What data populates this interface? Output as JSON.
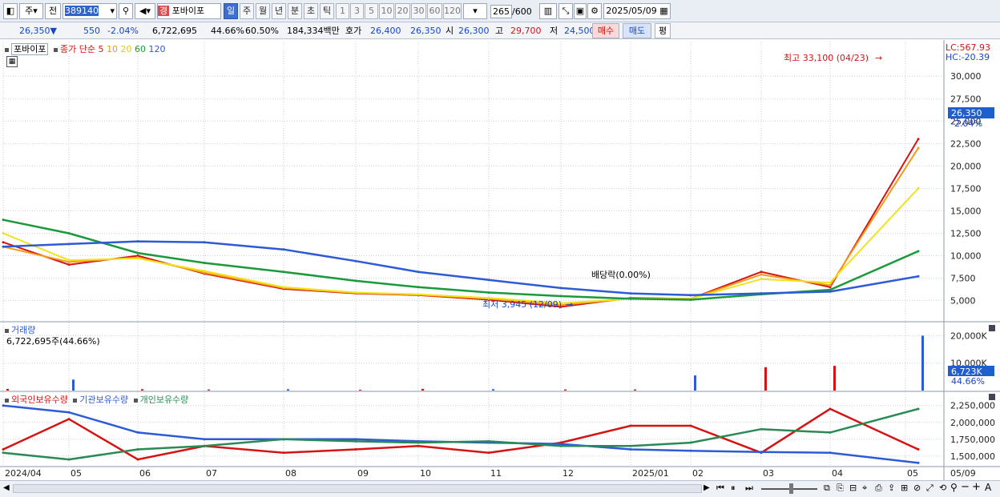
{
  "toolbar": {
    "market_label": "주",
    "prev_label": "전",
    "stock_code": "389140",
    "market_badge": "경",
    "stock_name": "포바이포",
    "periods": [
      "일",
      "주",
      "월",
      "년",
      "분",
      "초",
      "틱"
    ],
    "selected_period": "일",
    "intervals": [
      "1",
      "3",
      "5",
      "10",
      "20",
      "30",
      "60",
      "120"
    ],
    "count_value": "265",
    "count_max": "/600",
    "date_value": "2025/05/09"
  },
  "quote": {
    "price": "26,350",
    "change_arrow": "▼",
    "change": "550",
    "change_pct": "-2.04%",
    "volume": "6,722,695",
    "volume_ratio": "44.66%",
    "turnover": "60.50%",
    "amount": "184,334백만",
    "ask_label": "호가",
    "ask": "26,400",
    "bid": "26,350",
    "open_label": "시",
    "open": "26,300",
    "high_label": "고",
    "high": "29,700",
    "low_label": "저",
    "low": "24,500",
    "buy_label": "매수",
    "sell_label": "매도",
    "avg_label": "평"
  },
  "price_panel": {
    "name": "포바이포",
    "ma_label": "종가 단순",
    "ma_periods": [
      {
        "label": "5",
        "color": "#d61313"
      },
      {
        "label": "10",
        "color": "#f29a1a"
      },
      {
        "label": "20",
        "color": "#f2e21c"
      },
      {
        "label": "60",
        "color": "#1a9a3a"
      },
      {
        "label": "120",
        "color": "#2d5bd6"
      }
    ],
    "lc_label": "LC:567.93",
    "hc_label": "HC:-20.39",
    "y_ticks": [
      "30,000",
      "27,500",
      "25,000",
      "22,500",
      "20,000",
      "17,500",
      "15,000",
      "12,500",
      "10,000",
      "7,500",
      "5,000"
    ],
    "current_price_tag": "26,350",
    "current_pct_tag": "-2.04%",
    "annotation_high": "최고 33,100 (04/23)",
    "annotation_low": "최저 3,945 (12/09)",
    "annotation_dividend": "배당락(0.00%)"
  },
  "volume_panel": {
    "title": "거래량",
    "value": "6,722,695주(44.66%)",
    "y_ticks": [
      "20,000K",
      "10,000K"
    ],
    "current_tag": "6,723K",
    "pct_tag": "44.66%"
  },
  "holdings_panel": {
    "series": [
      {
        "label": "외국인보유수량",
        "color": "#d61313"
      },
      {
        "label": "기관보유수량",
        "color": "#2d5bd6"
      },
      {
        "label": "개인보유수량",
        "color": "#2a8a55"
      }
    ],
    "y_ticks": [
      "2,250,000",
      "2,000,000",
      "1,750,000",
      "1,500,000"
    ]
  },
  "x_axis": [
    "2024/04",
    "05",
    "06",
    "07",
    "08",
    "09",
    "10",
    "11",
    "12",
    "2025/01",
    "02",
    "03",
    "04",
    "05",
    "05/09"
  ],
  "chart_data": [
    {
      "type": "line",
      "title": "포바이포",
      "xlabel": "",
      "ylabel": "",
      "x": [
        "2024/04",
        "05",
        "06",
        "07",
        "08",
        "09",
        "10",
        "11",
        "12",
        "2025/01",
        "02",
        "03",
        "04",
        "05"
      ],
      "series": [
        {
          "name": "5",
          "values": [
            11500,
            9000,
            10000,
            8000,
            6300,
            5800,
            5600,
            5100,
            4300,
            5300,
            5200,
            8200,
            6500,
            23000
          ]
        },
        {
          "name": "10",
          "values": [
            11000,
            9300,
            9800,
            8100,
            6400,
            5850,
            5650,
            5200,
            4500,
            5250,
            5200,
            7900,
            6700,
            22000
          ]
        },
        {
          "name": "20",
          "values": [
            12500,
            9500,
            9700,
            8300,
            6500,
            5900,
            5700,
            5300,
            4700,
            5200,
            5200,
            7400,
            7000,
            17500
          ]
        },
        {
          "name": "60",
          "values": [
            14000,
            12500,
            10300,
            9200,
            8200,
            7200,
            6500,
            5900,
            5500,
            5200,
            5100,
            5700,
            6200,
            10500
          ]
        },
        {
          "name": "120",
          "values": [
            11000,
            11300,
            11600,
            11500,
            10700,
            9400,
            8200,
            7300,
            6400,
            5800,
            5600,
            5800,
            6000,
            7700
          ]
        }
      ],
      "ylim": [
        3000,
        33500
      ]
    },
    {
      "type": "bar",
      "title": "거래량",
      "x": [
        "2024/04",
        "05",
        "06",
        "07",
        "08",
        "09",
        "10",
        "11",
        "12",
        "2025/01",
        "02",
        "03",
        "04",
        "05"
      ],
      "values_k": [
        600,
        4000,
        500,
        400,
        500,
        300,
        600,
        500,
        400,
        400,
        5500,
        8500,
        9000,
        20000
      ],
      "ylim": [
        0,
        21000
      ]
    },
    {
      "type": "line",
      "title": "",
      "x": [
        "2024/04",
        "05",
        "06",
        "07",
        "08",
        "09",
        "10",
        "11",
        "12",
        "2025/01",
        "02",
        "03",
        "04",
        "05"
      ],
      "series": [
        {
          "name": "외국인보유수량",
          "values": [
            1600000,
            2050000,
            1450000,
            1650000,
            1550000,
            1600000,
            1650000,
            1550000,
            1700000,
            1950000,
            1950000,
            1550000,
            2200000,
            1600000
          ]
        },
        {
          "name": "기관보유수량",
          "values": [
            2250000,
            2150000,
            1850000,
            1750000,
            1750000,
            1750000,
            1720000,
            1700000,
            1680000,
            1600000,
            1580000,
            1560000,
            1550000,
            1400000
          ]
        },
        {
          "name": "개인보유수량",
          "values": [
            1550000,
            1450000,
            1600000,
            1650000,
            1750000,
            1720000,
            1700000,
            1720000,
            1650000,
            1650000,
            1700000,
            1900000,
            1850000,
            2200000
          ]
        }
      ],
      "ylim": [
        1380000,
        2330000
      ]
    }
  ]
}
